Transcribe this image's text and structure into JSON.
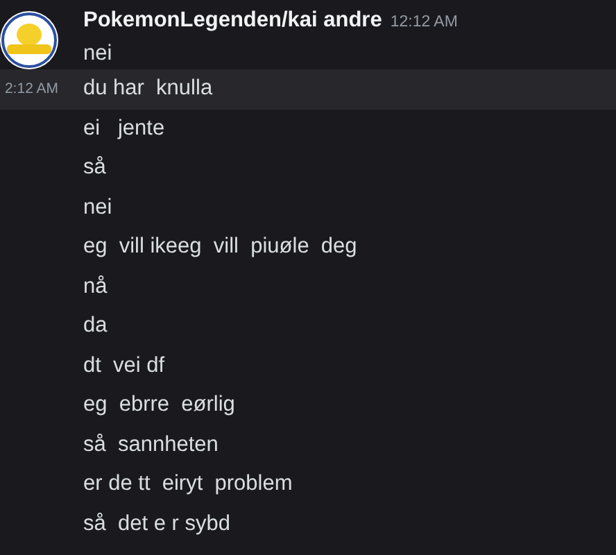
{
  "author": {
    "name": "PokemonLegenden/kai andre",
    "timestamp": "12:12 AM"
  },
  "messages": [
    {
      "text": "nei",
      "hovered": false
    },
    {
      "text": "du har  knulla",
      "hovered": true,
      "time": "2:12 AM"
    },
    {
      "text": "ei   jente",
      "hovered": false
    },
    {
      "text": "så",
      "hovered": false
    },
    {
      "text": "nei",
      "hovered": false
    },
    {
      "text": "eg  vill ikeeg  vill  piuøle  deg",
      "hovered": false
    },
    {
      "text": "nå",
      "hovered": false
    },
    {
      "text": "da",
      "hovered": false
    },
    {
      "text": "dt  vei df",
      "hovered": false
    },
    {
      "text": "eg  ebrre  eørlig",
      "hovered": false
    },
    {
      "text": "så  sannheten",
      "hovered": false
    },
    {
      "text": "er de tt  eiryt  problem",
      "hovered": false
    },
    {
      "text": "så  det e r sybd",
      "hovered": false
    }
  ]
}
